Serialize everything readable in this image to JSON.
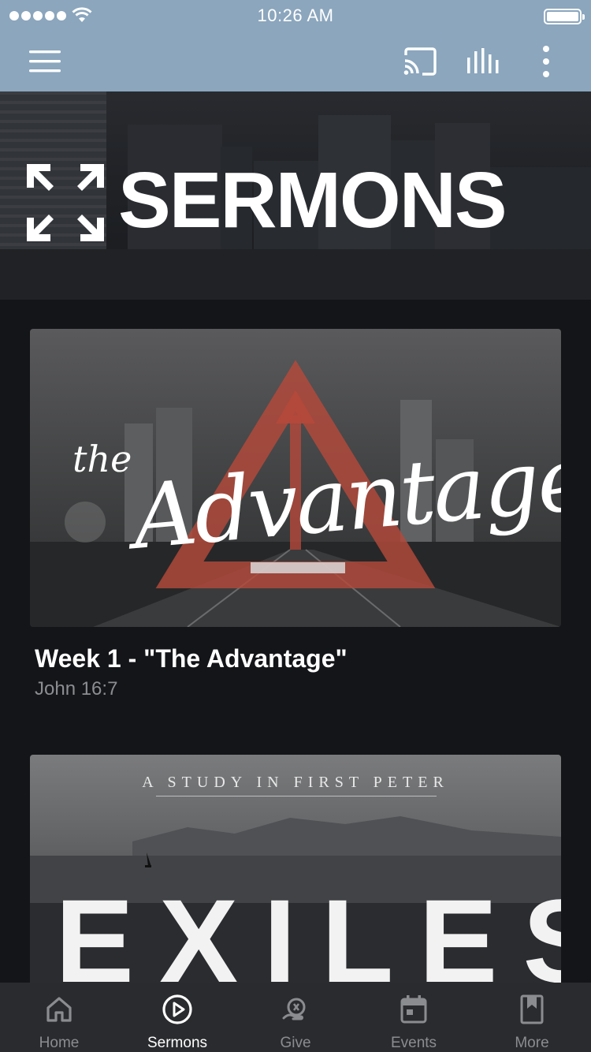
{
  "status_bar": {
    "time": "10:26 AM"
  },
  "header": {
    "menu_icon": "hamburger-menu-icon",
    "cast_icon": "cast-icon",
    "stats_icon": "audio-bars-icon",
    "more_icon": "vertical-dots-icon"
  },
  "hero": {
    "title": "SERMONS",
    "logo_icon": "four-arrows-logo"
  },
  "sermons": [
    {
      "title": "Week 1 - \"The Advantage\"",
      "subtitle": "John 16:7",
      "artwork_small": "the",
      "artwork_big": "Advantage"
    },
    {
      "artwork_kicker": "A STUDY IN FIRST PETER",
      "artwork_title": "EXILES"
    }
  ],
  "tabs": [
    {
      "label": "Home",
      "icon": "home-icon",
      "active": false
    },
    {
      "label": "Sermons",
      "icon": "play-circle-icon",
      "active": true
    },
    {
      "label": "Give",
      "icon": "give-icon",
      "active": false
    },
    {
      "label": "Events",
      "icon": "calendar-icon",
      "active": false
    },
    {
      "label": "More",
      "icon": "bookmark-book-icon",
      "active": false
    }
  ],
  "colors": {
    "header_bg": "#8ba6bd",
    "page_bg": "#141518",
    "tabbar_bg": "#2a2b2e",
    "accent_red": "#b5493b"
  }
}
